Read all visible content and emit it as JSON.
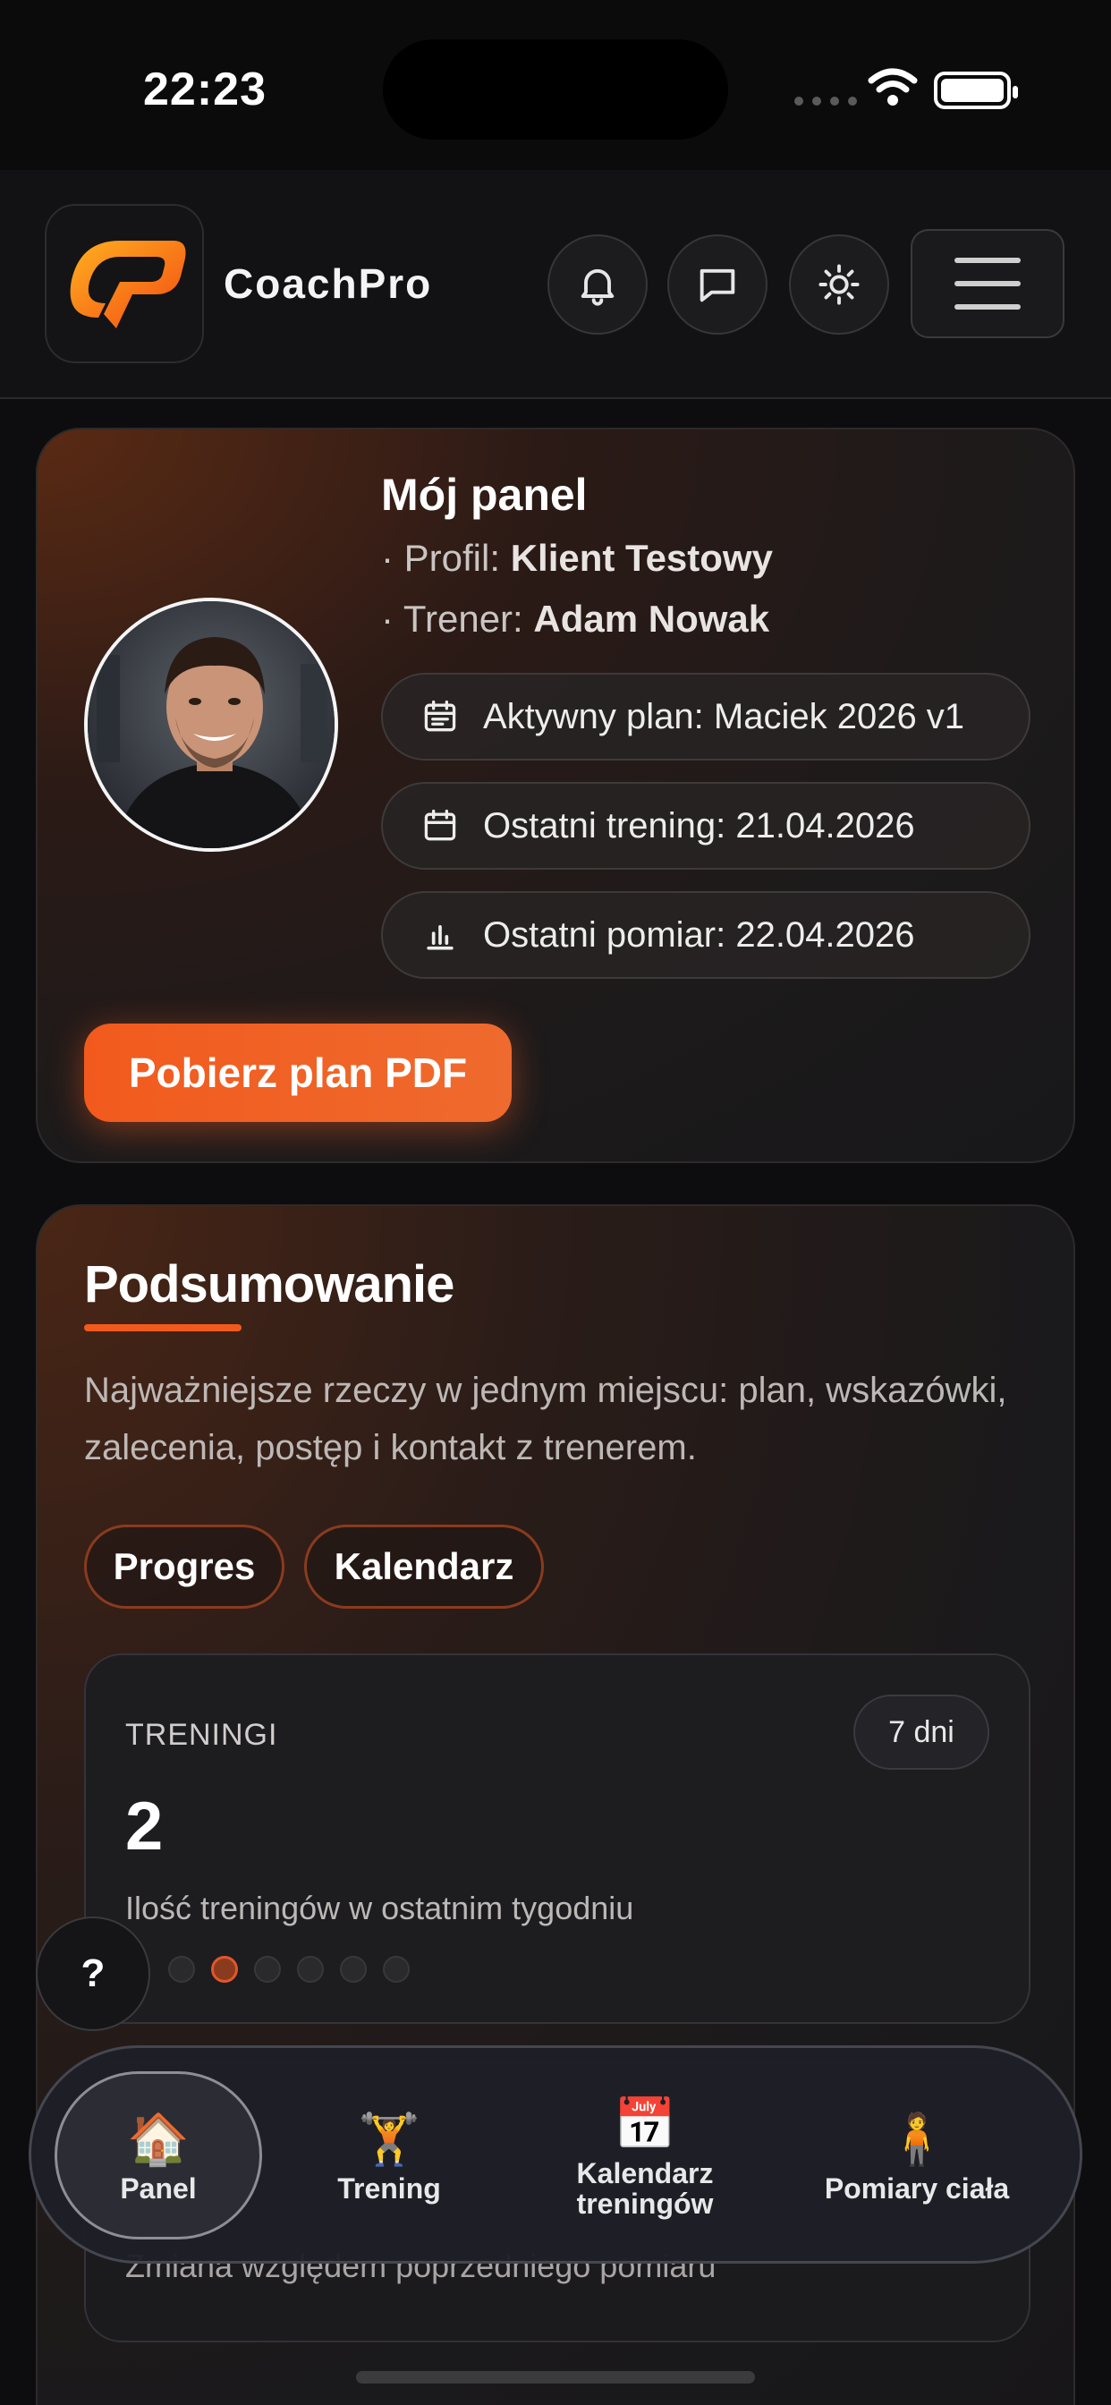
{
  "status_bar": {
    "time": "22:23"
  },
  "header": {
    "brand": "CoachPro"
  },
  "profile": {
    "title": "Mój panel",
    "profile_prefix": "· Profil: ",
    "profile_name": "Klient Testowy",
    "trainer_prefix": "· Trener: ",
    "trainer_name": "Adam Nowak",
    "pills": [
      {
        "icon": "calendar-list-icon",
        "text": "Aktywny plan: Maciek 2026 v1"
      },
      {
        "icon": "calendar-icon",
        "text": "Ostatni trening: 21.04.2026"
      },
      {
        "icon": "bar-chart-icon",
        "text": "Ostatni pomiar: 22.04.2026"
      }
    ],
    "pdf_button": "Pobierz plan PDF"
  },
  "summary": {
    "title": "Podsumowanie",
    "description": "Najważniejsze rzeczy w jednym miejscu: plan, wskazówki, zalecenia, postęp i kontakt z trenerem.",
    "chips": [
      "Progres",
      "Kalendarz"
    ],
    "stat": {
      "label": "TRENINGI",
      "badge": "7 dni",
      "value": "2",
      "description": "Ilość treningów w ostatnim tygodniu"
    },
    "second_description": "Zmiana względem poprzedniego pomiaru"
  },
  "help_button": "?",
  "bottom_nav": [
    {
      "emoji": "🏠",
      "label": "Panel",
      "active": true
    },
    {
      "emoji": "🏋️",
      "label": "Trening",
      "active": false
    },
    {
      "emoji": "📅",
      "label": "Kalendarz treningów",
      "active": false
    },
    {
      "emoji": "🧍",
      "label": "Pomiary ciała",
      "active": false
    }
  ],
  "colors": {
    "accent": "#f25a1d",
    "background": "#0d0d0f"
  }
}
